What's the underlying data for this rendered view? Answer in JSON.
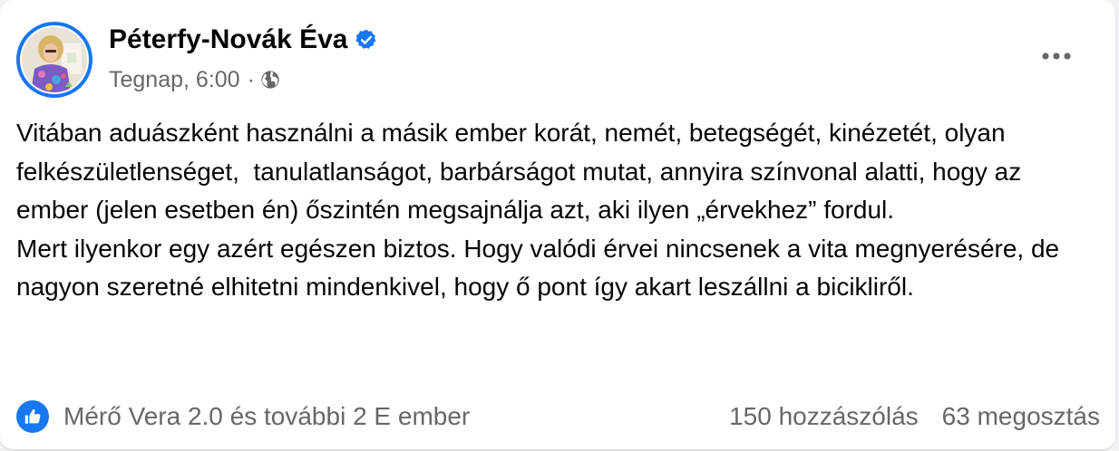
{
  "post": {
    "author": "Péterfy-Novák Éva",
    "timestamp": "Tegnap, 6:00",
    "separator": "·",
    "paragraphs": [
      "Vitában aduászként használni a másik ember korát, nemét, betegségét, kinézetét, olyan felkészületlenséget,  tanulatlanságot, barbárságot mutat, annyira színvonal alatti, hogy az ember (jelen esetben én) őszintén megsajnálja azt, aki ilyen „érvekhez” fordul.",
      "Mert ilyenkor egy azért egészen biztos. Hogy valódi érvei nincsenek a vita megnyerésére, de nagyon szeretné elhitetni mindenkivel, hogy ő pont így akart leszállni a bicikliről."
    ],
    "reactions_text": "Mérő Vera 2.0 és további 2 E ember",
    "comments_count": "150 hozzászólás",
    "shares_count": "63 megosztás"
  },
  "icons": {
    "verified": "verified-badge-icon",
    "audience": "globe-icon",
    "more": "more-options-icon",
    "reaction": "like-reaction-icon"
  },
  "colors": {
    "accent": "#1877f2",
    "text_primary": "#050505",
    "text_secondary": "#65676b",
    "background": "#ffffff"
  }
}
